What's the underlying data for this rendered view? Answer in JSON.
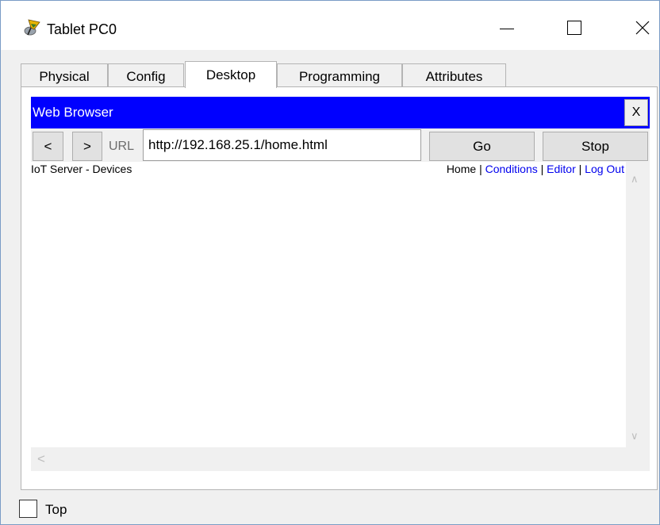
{
  "window": {
    "title": "Tablet PC0",
    "icon": "packet-tracer-tablet-icon",
    "controls": {
      "minimize": "minimize-icon",
      "maximize": "maximize-icon",
      "close": "close-icon"
    }
  },
  "tabs": [
    {
      "label": "Physical",
      "active": false
    },
    {
      "label": "Config",
      "active": false
    },
    {
      "label": "Desktop",
      "active": true
    },
    {
      "label": "Programming",
      "active": false
    },
    {
      "label": "Attributes",
      "active": false
    }
  ],
  "browser": {
    "title": "Web Browser",
    "close_label": "X",
    "back_label": "<",
    "forward_label": ">",
    "url_label": "URL",
    "url_value": "http://192.168.25.1/home.html",
    "go_label": "Go",
    "stop_label": "Stop",
    "header_color": "#0000ff"
  },
  "page": {
    "title": "IoT Server - Devices",
    "nav": {
      "home": "Home",
      "separator": "|",
      "conditions": "Conditions",
      "editor": "Editor",
      "logout": "Log Out"
    }
  },
  "bottom": {
    "top_checkbox_checked": false,
    "top_label": "Top"
  }
}
